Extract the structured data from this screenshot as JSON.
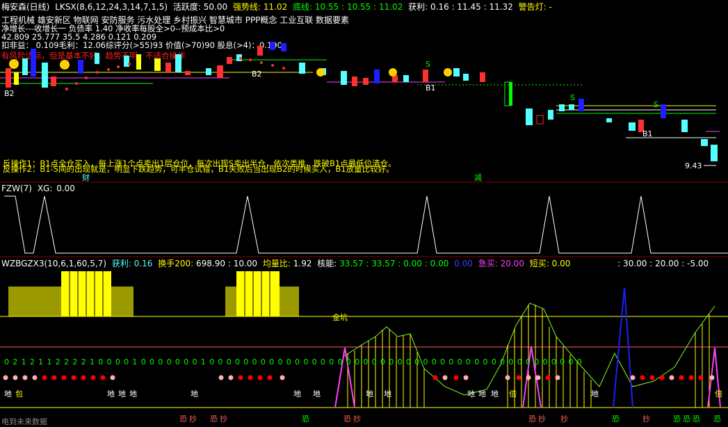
{
  "colors": {
    "bg": "#000000",
    "up_candle": "#ff3030",
    "down_candle": "#54ffff",
    "yellow": "#ffff00",
    "green": "#00ff00",
    "magenta": "#ff40ff",
    "blue": "#1e1eff",
    "olive": "#9a9a00",
    "white": "#ffffff",
    "pink": "#ffb0b0",
    "red": "#ff0000"
  },
  "header": {
    "stock": "梅安森(日线)",
    "ind": "LKSX(8,6,12,24,3,14,7,1,5)",
    "activity_label": "活跃度:",
    "activity_value": "50.00",
    "strong_label": "强势线:",
    "strong_value": "11.02",
    "bottom_label": "底线:",
    "bottom_values": "10.55 : 10.55 : 11.02",
    "profit_label": "获利:",
    "profit_values": "0.16 : 11.45 : 11.32",
    "alarm_label": "警告灯:",
    "alarm_value": "-"
  },
  "concepts": "工程机械 雄安新区 物联网 安防服务 污水处理 乡村振兴 智慧城市 PPP概念 工业互联 数据要素",
  "info_rows": [
    "净增长---收增长一 负债率 1.40 净收率每股全>0--预成本比>0",
    "42.809     25.777     35.5     4.286     0.121     0.209",
    "扣非益：  0.109毛利：12.06综评分(>55)93  价值(>70)90  股息(>4)：0.190"
  ],
  "warning_text": "有风险边际，但是基本不好，趋势不明，不适合操作",
  "ops": [
    "反操作1：B1点全仓买入，每上涨1个点卖出1层仓位，每次出现S卖出半仓，依次类推，跌破B1点最低位清仓。",
    "反操作2：B1-S间的出现就是，明显下跌趋势，可半仓试错，B1失败后当出现B2的时候买入，B1放量比较好。"
  ],
  "pane1_markers": {
    "cai": "财",
    "jian": "减",
    "price_label": "9.43",
    "b1": "B1",
    "b2": "B2",
    "s": "S"
  },
  "pane2": {
    "label": "FZW(7)",
    "xg_label": "XG:",
    "xg_value": "0.00"
  },
  "pane3": {
    "label": "WZBGZX3(10,6,1,60,5,7)",
    "profit_label": "获利:",
    "profit_value": "0.16",
    "turnover_label": "换手200:",
    "turnover_values": "698.90 : 10.00",
    "ratio_label": "均量比:",
    "ratio_value": "1.92",
    "core_label": "核能:",
    "core_values": "33.57 : 33.57 : 0.00 : 0.00",
    "zero_blue": "0.00",
    "urgent_label": "急买:",
    "urgent_value": "20.00",
    "short_label": "短买:",
    "short_value": "0.00",
    "tail_values": ": 30.00 : 20.00 : -5.00",
    "gold_pit": "金坑",
    "digit_row": "0 2 1 2 1 1 2 2 2 2 1 0 0 0 0 1 0 0 0 0 0 0 0 1 0 0 0 0 0 0 0 0 0 0 0 0 0 0 0 0 0 0 0 0 0 0 0 0 0 0 0 0 0 0 0 0 0 0 0 0 0 0 0 0 0 0 0 0",
    "di_labels": [
      "地",
      "包",
      "地",
      "地",
      "地",
      "地",
      "地",
      "地",
      "地",
      "地",
      "地",
      "地",
      "地",
      "倍",
      "地",
      "倍"
    ],
    "bottom_labels": [
      "恐",
      "抄",
      "恐",
      "抄",
      "恐",
      "恐",
      "抄",
      "恐",
      "抄",
      "抄",
      "恐",
      "抄",
      "恐",
      "恐",
      "恐",
      "恐"
    ]
  },
  "footer": "电到未来数据"
}
